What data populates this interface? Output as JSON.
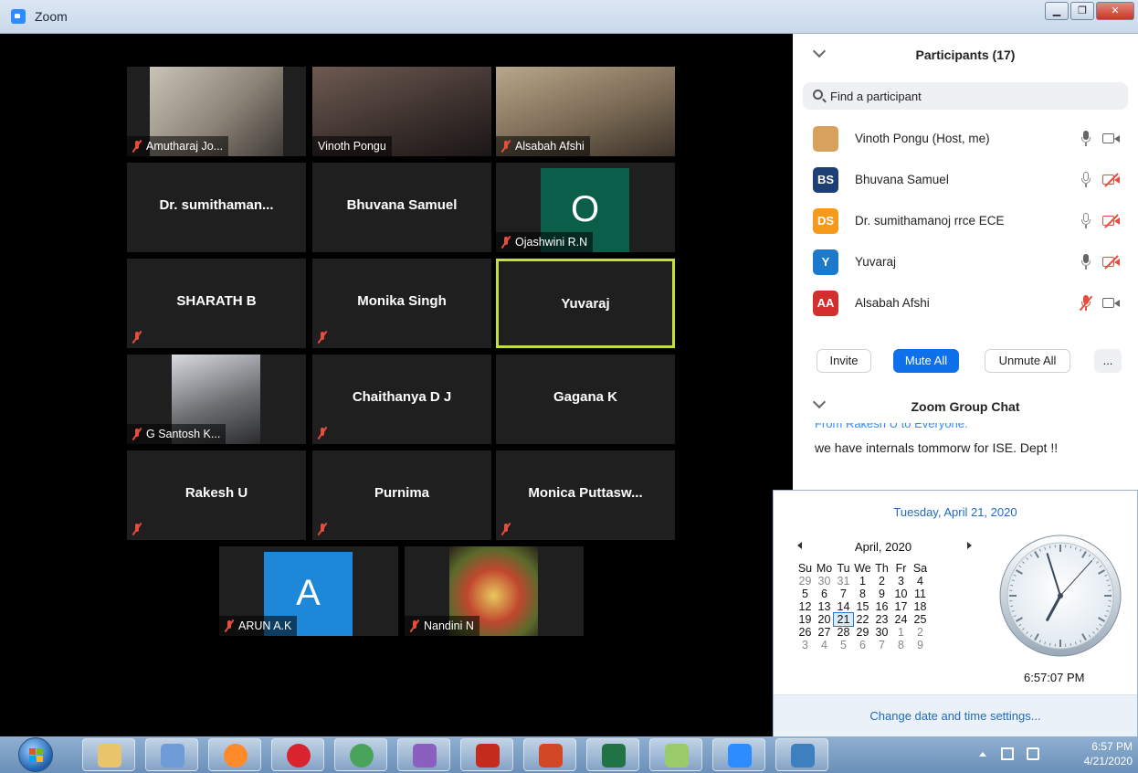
{
  "window": {
    "title": "Zoom"
  },
  "grid": {
    "rows": [
      [
        {
          "label": "Amutharaj Jo...",
          "muted": true,
          "kind": "photo"
        },
        {
          "label": "Vinoth Pongu",
          "muted": false,
          "kind": "photo"
        },
        {
          "label": "Alsabah Afshi",
          "muted": true,
          "kind": "photo"
        }
      ],
      [
        {
          "big": "Dr. sumithaman...",
          "kind": "name"
        },
        {
          "big": "Bhuvana Samuel",
          "kind": "name"
        },
        {
          "label": "Ojashwini R.N",
          "muted": true,
          "kind": "avatar",
          "letter": "O",
          "color": "#0b5e4a"
        }
      ],
      [
        {
          "big": "SHARATH B",
          "muted": true,
          "kind": "name"
        },
        {
          "big": "Monika Singh",
          "muted": true,
          "kind": "name"
        },
        {
          "big": "Yuvaraj",
          "kind": "name",
          "active": true
        }
      ],
      [
        {
          "label": "G Santosh K...",
          "muted": true,
          "kind": "photo"
        },
        {
          "big": "Chaithanya D J",
          "muted": true,
          "kind": "name"
        },
        {
          "big": "Gagana K",
          "kind": "name"
        }
      ],
      [
        {
          "big": "Rakesh U",
          "muted": true,
          "kind": "name"
        },
        {
          "big": "Purnima",
          "muted": true,
          "kind": "name"
        },
        {
          "big": "Monica  Puttasw...",
          "muted": true,
          "kind": "name"
        }
      ],
      [
        {
          "label": "ARUN A.K",
          "muted": true,
          "kind": "avatar",
          "letter": "A",
          "color": "#1e88d8"
        },
        {
          "label": "Nandini N",
          "muted": true,
          "kind": "photo"
        }
      ]
    ]
  },
  "participants": {
    "title": "Participants (17)",
    "search_placeholder": "Find a participant",
    "list": [
      {
        "name": "Vinoth Pongu (Host, me)",
        "initials": "",
        "color": "#d8a25e",
        "mic": "on",
        "cam": "on"
      },
      {
        "name": "Bhuvana Samuel",
        "initials": "BS",
        "color": "#1d3f73",
        "mic": "idle",
        "cam": "off"
      },
      {
        "name": "Dr. sumithamanoj rrce ECE",
        "initials": "DS",
        "color": "#f49b1c",
        "mic": "idle",
        "cam": "off"
      },
      {
        "name": "Yuvaraj",
        "initials": "Y",
        "color": "#1d79c9",
        "mic": "on",
        "cam": "off"
      },
      {
        "name": "Alsabah Afshi",
        "initials": "AA",
        "color": "#d32f2f",
        "mic": "muted",
        "cam": "on"
      }
    ],
    "buttons": {
      "invite": "Invite",
      "mute_all": "Mute All",
      "unmute_all": "Unmute All",
      "more": "..."
    }
  },
  "chat": {
    "title": "Zoom Group Chat",
    "from": "From Rakesh U to Everyone:",
    "message": "we have internals tommorw for ISE. Dept !!"
  },
  "calendar": {
    "date_title": "Tuesday, April 21, 2020",
    "month": "April, 2020",
    "weekdays": [
      "Su",
      "Mo",
      "Tu",
      "We",
      "Th",
      "Fr",
      "Sa"
    ],
    "weeks": [
      [
        "29",
        "30",
        "31",
        "1",
        "2",
        "3",
        "4"
      ],
      [
        "5",
        "6",
        "7",
        "8",
        "9",
        "10",
        "11"
      ],
      [
        "12",
        "13",
        "14",
        "15",
        "16",
        "17",
        "18"
      ],
      [
        "19",
        "20",
        "21",
        "22",
        "23",
        "24",
        "25"
      ],
      [
        "26",
        "27",
        "28",
        "29",
        "30",
        "1",
        "2"
      ],
      [
        "3",
        "4",
        "5",
        "6",
        "7",
        "8",
        "9"
      ]
    ],
    "selected_day": "21",
    "time": "6:57:07 PM",
    "settings_link": "Change date and time settings...",
    "clock": {
      "hour": 6,
      "minute": 57,
      "second": 7
    }
  },
  "taskbar": {
    "items": [
      "file-explorer-icon",
      "skype-icon",
      "firefox-icon",
      "opera-icon",
      "chrome-icon",
      "paint-icon",
      "acrobat-icon",
      "powerpoint-icon",
      "excel-icon",
      "sticky-notes-icon",
      "zoom-icon",
      "photo-viewer-icon"
    ],
    "time": "6:57 PM",
    "date": "4/21/2020"
  }
}
